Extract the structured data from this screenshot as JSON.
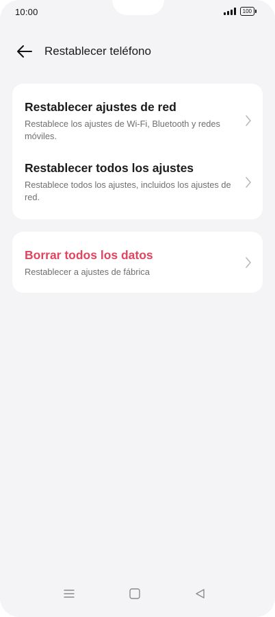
{
  "status_bar": {
    "time": "10:00",
    "battery": "100"
  },
  "header": {
    "title": "Restablecer teléfono"
  },
  "reset_options": [
    {
      "title": "Restablecer ajustes de red",
      "description": "Restablece los ajustes de Wi-Fi, Bluetooth y redes móviles."
    },
    {
      "title": "Restablecer todos los ajustes",
      "description": "Restablece todos los ajustes, incluidos los ajustes de red."
    }
  ],
  "erase": {
    "title": "Borrar todos los datos",
    "description": "Restablecer a ajustes de fábrica",
    "accent_color": "#e0445e"
  },
  "icons": {
    "back": "arrow-left-icon",
    "chevron": "chevron-right-icon",
    "nav": [
      "menu-icon",
      "home-icon",
      "back-triangle-icon"
    ]
  }
}
